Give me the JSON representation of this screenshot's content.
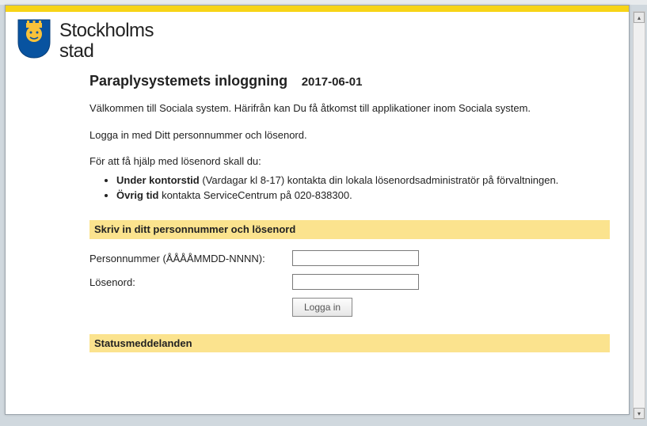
{
  "brand": {
    "line1": "Stockholms",
    "line2": "stad"
  },
  "page": {
    "title": "Paraplysystemets inloggning",
    "date": "2017-06-01"
  },
  "intro": {
    "welcome": "Välkommen till Sociala system. Härifrån kan Du få åtkomst till applikationer inom Sociala system.",
    "login_hint": "Logga in med Ditt personnummer och lösenord.",
    "help_heading": "För att få hjälp med lösenord skall du:"
  },
  "help_items": [
    {
      "bold": "Under kontorstid",
      "rest": " (Vardagar kl 8-17) kontakta din lokala lösenordsadministratör på förvaltningen."
    },
    {
      "bold": "Övrig tid",
      "rest": " kontakta ServiceCentrum på 020-838300."
    }
  ],
  "sections": {
    "credentials": "Skriv in ditt personnummer och lösenord",
    "status": "Statusmeddelanden"
  },
  "form": {
    "personnummer_label": "Personnummer (ÅÅÅÅMMDD-NNNN):",
    "losenord_label": "Lösenord:",
    "login_button": "Logga in"
  }
}
